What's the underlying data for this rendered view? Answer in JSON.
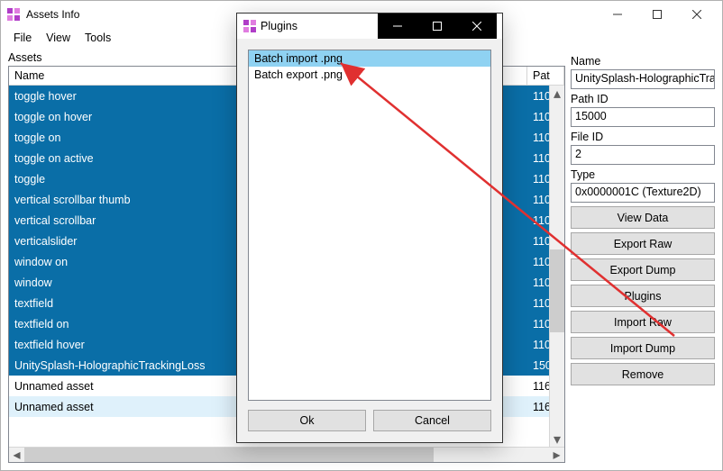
{
  "window": {
    "title": "Assets Info",
    "menu": {
      "file": "File",
      "view": "View",
      "tools": "Tools"
    }
  },
  "assets": {
    "label": "Assets",
    "columns": {
      "name": "Name",
      "path": "Pat"
    },
    "rows": [
      {
        "name": "toggle hover",
        "path": "110",
        "style": "sel"
      },
      {
        "name": "toggle on hover",
        "path": "110",
        "style": "sel"
      },
      {
        "name": "toggle on",
        "path": "110",
        "style": "sel"
      },
      {
        "name": "toggle on active",
        "path": "110",
        "style": "sel"
      },
      {
        "name": "toggle",
        "path": "110",
        "style": "sel"
      },
      {
        "name": "vertical scrollbar thumb",
        "path": "110",
        "style": "sel"
      },
      {
        "name": "vertical scrollbar",
        "path": "110",
        "style": "sel"
      },
      {
        "name": "verticalslider",
        "path": "110",
        "style": "sel"
      },
      {
        "name": "window on",
        "path": "110",
        "style": "sel"
      },
      {
        "name": "window",
        "path": "110",
        "style": "sel"
      },
      {
        "name": "textfield",
        "path": "110",
        "style": "sel"
      },
      {
        "name": "textfield on",
        "path": "110",
        "style": "sel"
      },
      {
        "name": "textfield hover",
        "path": "110",
        "style": "sel"
      },
      {
        "name": "UnitySplash-HolographicTrackingLoss",
        "path": "150",
        "style": "sel"
      },
      {
        "name": "Unnamed asset",
        "path": "116",
        "style": "plain"
      },
      {
        "name": "Unnamed asset",
        "path": "116",
        "style": "light"
      }
    ]
  },
  "props": {
    "name_label": "Name",
    "name_value": "UnitySplash-HolographicTracking",
    "pathid_label": "Path ID",
    "pathid_value": "15000",
    "fileid_label": "File ID",
    "fileid_value": "2",
    "type_label": "Type",
    "type_value": "0x0000001C (Texture2D)",
    "buttons": {
      "view_data": "View Data",
      "export_raw": "Export Raw",
      "export_dump": "Export Dump",
      "plugins": "Plugins",
      "import_raw": "Import Raw",
      "import_dump": "Import Dump",
      "remove": "Remove"
    }
  },
  "modal": {
    "title": "Plugins",
    "items": [
      {
        "label": "Batch import .png",
        "selected": true
      },
      {
        "label": "Batch export .png",
        "selected": false
      }
    ],
    "ok": "Ok",
    "cancel": "Cancel"
  },
  "icons": {
    "app_color1": "#b03dc8",
    "app_color2": "#e07de0"
  }
}
